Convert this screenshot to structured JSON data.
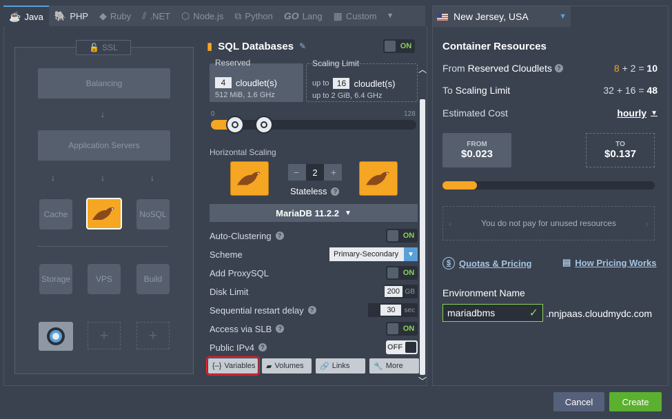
{
  "tabs": [
    {
      "label": "Java",
      "icon": "java-icon"
    },
    {
      "label": "PHP",
      "icon": "php-icon"
    },
    {
      "label": "Ruby",
      "icon": "ruby-icon"
    },
    {
      "label": ".NET",
      "icon": "dotnet-icon"
    },
    {
      "label": "Node.js",
      "icon": "nodejs-icon"
    },
    {
      "label": "Python",
      "icon": "python-icon"
    },
    {
      "label": "Lang",
      "icon": "go-icon",
      "prefix": "GO"
    },
    {
      "label": "Custom",
      "icon": "custom-icon"
    }
  ],
  "topology": {
    "ssl": "SSL",
    "balancing": "Balancing",
    "app_servers": "Application Servers",
    "cache": "Cache",
    "nosql": "NoSQL",
    "storage": "Storage",
    "vps": "VPS",
    "build": "Build"
  },
  "sql": {
    "title": "SQL Databases",
    "toggle": "ON",
    "reserved": {
      "label": "Reserved",
      "value": "4",
      "unit": "cloudlet(s)",
      "specs": "512 MiB, 1.6 GHz"
    },
    "scaling": {
      "label": "Scaling Limit",
      "prefix": "up to",
      "value": "16",
      "unit": "cloudlet(s)",
      "specs": "up to 2 GiB, 6.4 GHz"
    },
    "slider_min": "0",
    "slider_max": "128",
    "horizontal_scaling": "Horizontal Scaling",
    "node_count": "2",
    "stateless": "Stateless",
    "version": "MariaDB 11.2.2",
    "options": {
      "auto_clustering": {
        "label": "Auto-Clustering",
        "value": "ON"
      },
      "scheme": {
        "label": "Scheme",
        "value": "Primary-Secondary"
      },
      "proxysql": {
        "label": "Add ProxySQL",
        "value": "ON"
      },
      "disk": {
        "label": "Disk Limit",
        "value": "200",
        "unit": "GB"
      },
      "restart": {
        "label": "Sequential restart delay",
        "value": "30",
        "unit": "sec"
      },
      "slb": {
        "label": "Access via SLB",
        "value": "ON"
      },
      "ipv4": {
        "label": "Public IPv4",
        "value": "OFF"
      }
    },
    "buttons": {
      "variables": "Variables",
      "volumes": "Volumes",
      "links": "Links",
      "more": "More"
    }
  },
  "right": {
    "region": "New Jersey, USA",
    "title": "Container Resources",
    "from_label": "From",
    "from_bold": "Reserved Cloudlets",
    "from_calc_a": "8",
    "from_calc_rest": "+ 2 =",
    "from_total": "10",
    "to_label": "To",
    "to_bold": "Scaling Limit",
    "to_calc": "32 + 16 =",
    "to_total": "48",
    "est_cost": "Estimated Cost",
    "period": "hourly",
    "price_from_label": "FROM",
    "price_from": "$0.023",
    "price_to_label": "TO",
    "price_to": "$0.137",
    "info": "You do not pay for unused resources",
    "quotas": "Quotas & Pricing",
    "how_pricing": "How Pricing Works",
    "env_name_label": "Environment Name",
    "env_name": "mariadbms",
    "env_suffix": ".nnjpaas.cloudmydc.com"
  },
  "footer": {
    "cancel": "Cancel",
    "create": "Create"
  },
  "colors": {
    "accent": "#f5a623",
    "primary": "#5aa0d8",
    "success": "#8bd35a",
    "create_btn": "#5cb030",
    "highlight": "#e8202a"
  }
}
